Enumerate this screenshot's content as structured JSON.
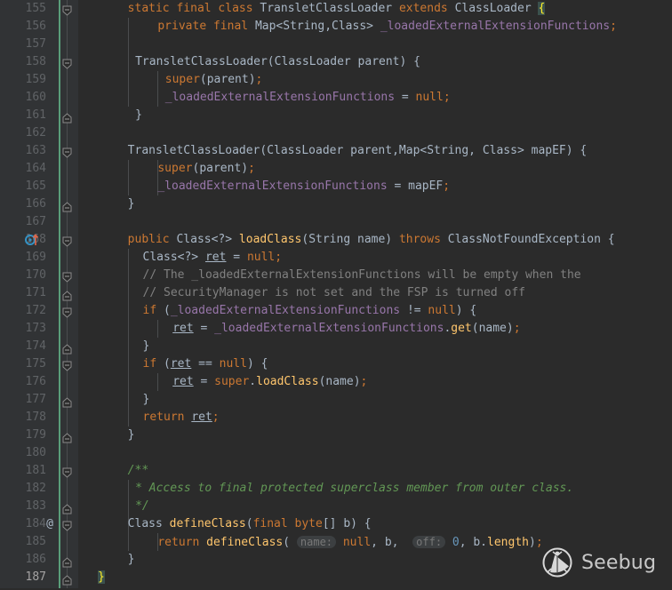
{
  "editor": {
    "theme": "darcula",
    "background": "#2b2b2b",
    "gutter_background": "#313335",
    "line_height_px": 20,
    "first_line": 155,
    "last_line": 187,
    "current_line": 187,
    "colors": {
      "keyword": "#cc7832",
      "text": "#a9b7c6",
      "field": "#9876aa",
      "method": "#ffc66d",
      "number": "#6897bb",
      "comment": "#808080",
      "javadoc": "#629755",
      "line_number": "#606366",
      "line_number_current": "#a4a3a3",
      "brace_match_bg": "#3b514d",
      "brace_match_fg": "#ffef28",
      "vcs_marker": "#5a9e7a",
      "hint_bg": "#3c3f41",
      "hint_fg": "#787878"
    }
  },
  "gutter": {
    "icons": [
      {
        "line": 168,
        "name": "implementing-method-icon",
        "glyph": "override-arrow"
      },
      {
        "line": 184,
        "name": "annotation-marker",
        "glyph": "@"
      }
    ],
    "fold_lines": [
      155,
      158,
      161,
      163,
      166,
      168,
      170,
      171,
      172,
      174,
      175,
      177,
      179,
      181,
      183,
      184,
      186,
      187
    ]
  },
  "lines": [
    {
      "n": 155,
      "indent": 4,
      "text": "static final class TransletClassLoader extends ClassLoader {"
    },
    {
      "n": 156,
      "indent": 8,
      "text": "private final Map<String,Class> _loadedExternalExtensionFunctions;"
    },
    {
      "n": 157,
      "indent": 0,
      "text": ""
    },
    {
      "n": 158,
      "indent": 5,
      "text": "TransletClassLoader(ClassLoader parent) {"
    },
    {
      "n": 159,
      "indent": 9,
      "text": "super(parent);"
    },
    {
      "n": 160,
      "indent": 9,
      "text": "_loadedExternalExtensionFunctions = null;"
    },
    {
      "n": 161,
      "indent": 5,
      "text": "}"
    },
    {
      "n": 162,
      "indent": 0,
      "text": ""
    },
    {
      "n": 163,
      "indent": 4,
      "text": "TransletClassLoader(ClassLoader parent,Map<String, Class> mapEF) {"
    },
    {
      "n": 164,
      "indent": 8,
      "text": "super(parent);"
    },
    {
      "n": 165,
      "indent": 8,
      "text": "_loadedExternalExtensionFunctions = mapEF;"
    },
    {
      "n": 166,
      "indent": 4,
      "text": "}"
    },
    {
      "n": 167,
      "indent": 0,
      "text": ""
    },
    {
      "n": 168,
      "indent": 4,
      "text": "public Class<?> loadClass(String name) throws ClassNotFoundException {"
    },
    {
      "n": 169,
      "indent": 6,
      "text": "Class<?> ret = null;"
    },
    {
      "n": 170,
      "indent": 6,
      "text": "// The _loadedExternalExtensionFunctions will be empty when the"
    },
    {
      "n": 171,
      "indent": 6,
      "text": "// SecurityManager is not set and the FSP is turned off"
    },
    {
      "n": 172,
      "indent": 6,
      "text": "if (_loadedExternalExtensionFunctions != null) {"
    },
    {
      "n": 173,
      "indent": 10,
      "text": "ret = _loadedExternalExtensionFunctions.get(name);"
    },
    {
      "n": 174,
      "indent": 6,
      "text": "}"
    },
    {
      "n": 175,
      "indent": 6,
      "text": "if (ret == null) {"
    },
    {
      "n": 176,
      "indent": 10,
      "text": "ret = super.loadClass(name);"
    },
    {
      "n": 177,
      "indent": 6,
      "text": "}"
    },
    {
      "n": 178,
      "indent": 6,
      "text": "return ret;"
    },
    {
      "n": 179,
      "indent": 4,
      "text": "}"
    },
    {
      "n": 180,
      "indent": 0,
      "text": ""
    },
    {
      "n": 181,
      "indent": 4,
      "text": "/**"
    },
    {
      "n": 182,
      "indent": 5,
      "text": "* Access to final protected superclass member from outer class."
    },
    {
      "n": 183,
      "indent": 5,
      "text": "*/"
    },
    {
      "n": 184,
      "indent": 4,
      "text": "Class defineClass(final byte[] b) {"
    },
    {
      "n": 185,
      "indent": 8,
      "text": "return defineClass( name: null, b,  off: 0, b.length);"
    },
    {
      "n": 186,
      "indent": 4,
      "text": "}"
    },
    {
      "n": 187,
      "indent": 0,
      "text": "}"
    }
  ],
  "inlay_hints": [
    {
      "line": 185,
      "label": "name:"
    },
    {
      "line": 185,
      "label": "off:"
    }
  ],
  "watermark": {
    "label": "Seebug",
    "icon": "seebug-bug-logo"
  }
}
